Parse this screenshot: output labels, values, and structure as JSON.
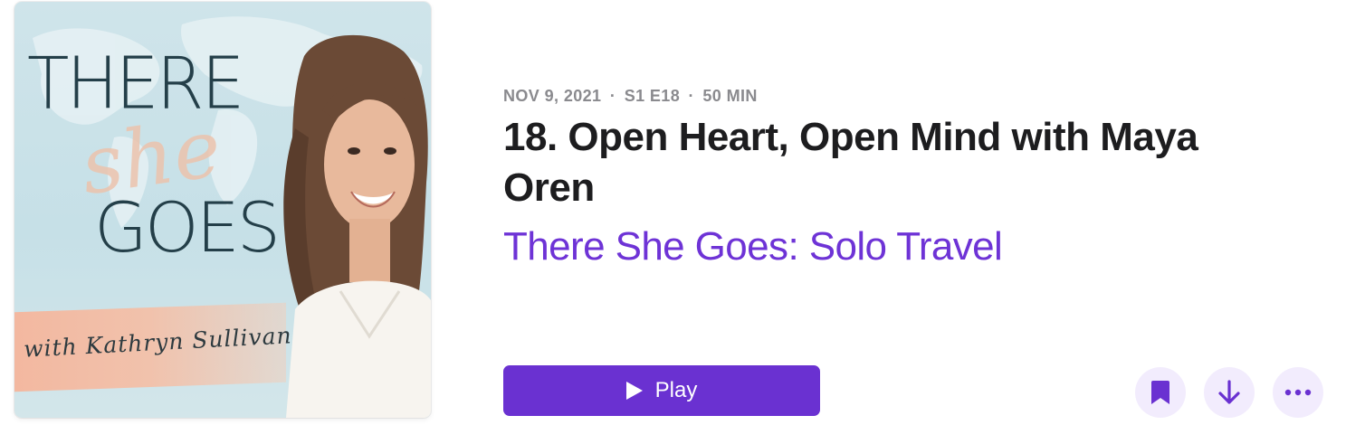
{
  "artwork": {
    "title_line1": "THERE",
    "title_script": "she",
    "title_line2": "GOES",
    "host_line": "with Kathryn Sullivan"
  },
  "episode": {
    "date": "NOV 9, 2021",
    "season_episode": "S1 E18",
    "duration": "50 MIN",
    "separator": "·",
    "title": "18. Open Heart, Open Mind with Maya Oren",
    "show_name": "There She Goes: Solo Travel"
  },
  "actions": {
    "play_label": "Play",
    "save_icon": "bookmark-icon",
    "download_icon": "arrow-down-icon",
    "more_icon": "ellipsis-icon"
  },
  "colors": {
    "accent": "#6a31d1",
    "show_link": "#6e33d6",
    "icon_button_bg": "#f2ecfd",
    "meta_text": "#8a8a8e",
    "title_text": "#1d1d1f"
  }
}
